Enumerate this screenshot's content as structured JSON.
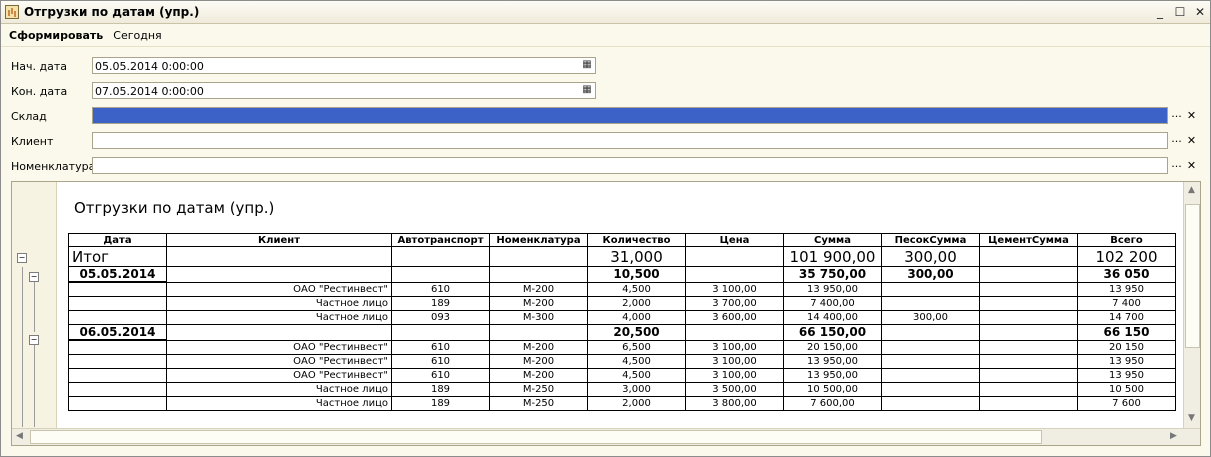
{
  "window": {
    "title": "Отгрузки по датам (упр.)",
    "minimize": "_",
    "maximize": "☐",
    "close": "✕"
  },
  "toolbar": {
    "generate": "Сформировать",
    "today": "Сегодня"
  },
  "form": {
    "start_label": "Нач. дата",
    "start_value": "05.05.2014  0:00:00",
    "end_label": "Кон. дата",
    "end_value": "07.05.2014  0:00:00",
    "warehouse_label": "Склад",
    "warehouse_value": "",
    "client_label": "Клиент",
    "client_value": "",
    "nomenclature_label": "Номенклатура",
    "nomenclature_value": "",
    "select_glyph": "...",
    "clear_glyph": "✕",
    "calendar_glyph": "▦"
  },
  "report": {
    "title": "Отгрузки по датам (упр.)",
    "headers": [
      "Дата",
      "Клиент",
      "Автотранспорт",
      "Номенклатура",
      "Количество",
      "Цена",
      "Сумма",
      "ПесокСумма",
      "ЦементСумма",
      "Всего"
    ],
    "total": {
      "label": "Итог",
      "qty": "31,000",
      "sum": "101 900,00",
      "sand": "300,00",
      "all": "102 200"
    },
    "groups": [
      {
        "date": "05.05.2014",
        "qty": "10,500",
        "sum": "35 750,00",
        "sand": "300,00",
        "all": "36 050",
        "rows": [
          {
            "client": "ОАО \"Рестинвест\"",
            "truck": "610",
            "nom": "М-200",
            "qty": "4,500",
            "price": "3 100,00",
            "sum": "13 950,00",
            "sand": "",
            "cement": "",
            "all": "13 950"
          },
          {
            "client": "Частное лицо",
            "truck": "189",
            "nom": "М-200",
            "qty": "2,000",
            "price": "3 700,00",
            "sum": "7 400,00",
            "sand": "",
            "cement": "",
            "all": "7 400"
          },
          {
            "client": "Частное лицо",
            "truck": "093",
            "nom": "М-300",
            "qty": "4,000",
            "price": "3 600,00",
            "sum": "14 400,00",
            "sand": "300,00",
            "cement": "",
            "all": "14 700"
          }
        ]
      },
      {
        "date": "06.05.2014",
        "qty": "20,500",
        "sum": "66 150,00",
        "sand": "",
        "all": "66 150",
        "rows": [
          {
            "client": "ОАО \"Рестинвест\"",
            "truck": "610",
            "nom": "М-200",
            "qty": "6,500",
            "price": "3 100,00",
            "sum": "20 150,00",
            "sand": "",
            "cement": "",
            "all": "20 150"
          },
          {
            "client": "ОАО \"Рестинвест\"",
            "truck": "610",
            "nom": "М-200",
            "qty": "4,500",
            "price": "3 100,00",
            "sum": "13 950,00",
            "sand": "",
            "cement": "",
            "all": "13 950"
          },
          {
            "client": "ОАО \"Рестинвест\"",
            "truck": "610",
            "nom": "М-200",
            "qty": "4,500",
            "price": "3 100,00",
            "sum": "13 950,00",
            "sand": "",
            "cement": "",
            "all": "13 950"
          },
          {
            "client": "Частное лицо",
            "truck": "189",
            "nom": "М-250",
            "qty": "3,000",
            "price": "3 500,00",
            "sum": "10 500,00",
            "sand": "",
            "cement": "",
            "all": "10 500"
          },
          {
            "client": "Частное лицо",
            "truck": "189",
            "nom": "М-250",
            "qty": "2,000",
            "price": "3 800,00",
            "sum": "7 600,00",
            "sand": "",
            "cement": "",
            "all": "7 600"
          }
        ]
      }
    ]
  }
}
